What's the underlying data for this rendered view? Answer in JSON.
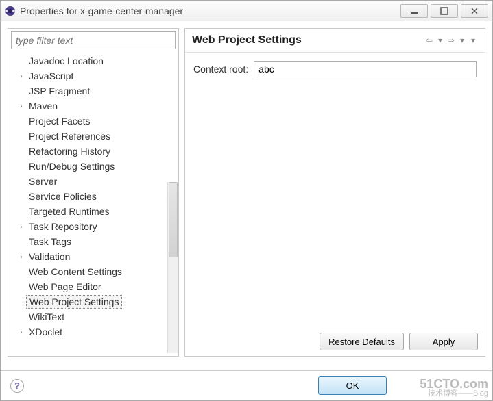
{
  "window": {
    "title": "Properties for x-game-center-manager"
  },
  "filter": {
    "placeholder": "type filter text"
  },
  "tree": [
    {
      "label": "Javadoc Location",
      "expandable": false
    },
    {
      "label": "JavaScript",
      "expandable": true
    },
    {
      "label": "JSP Fragment",
      "expandable": false
    },
    {
      "label": "Maven",
      "expandable": true
    },
    {
      "label": "Project Facets",
      "expandable": false
    },
    {
      "label": "Project References",
      "expandable": false
    },
    {
      "label": "Refactoring History",
      "expandable": false
    },
    {
      "label": "Run/Debug Settings",
      "expandable": false
    },
    {
      "label": "Server",
      "expandable": false
    },
    {
      "label": "Service Policies",
      "expandable": false
    },
    {
      "label": "Targeted Runtimes",
      "expandable": false
    },
    {
      "label": "Task Repository",
      "expandable": true
    },
    {
      "label": "Task Tags",
      "expandable": false
    },
    {
      "label": "Validation",
      "expandable": true
    },
    {
      "label": "Web Content Settings",
      "expandable": false
    },
    {
      "label": "Web Page Editor",
      "expandable": false
    },
    {
      "label": "Web Project Settings",
      "expandable": false,
      "selected": true
    },
    {
      "label": "WikiText",
      "expandable": false
    },
    {
      "label": "XDoclet",
      "expandable": true
    }
  ],
  "page": {
    "heading": "Web Project Settings",
    "context_root_label": "Context root:",
    "context_root_value": "abc"
  },
  "buttons": {
    "restore_defaults": "Restore Defaults",
    "apply": "Apply",
    "ok": "OK"
  },
  "watermark": {
    "main": "51CTO.com",
    "sub": "技术博客——Blog"
  }
}
